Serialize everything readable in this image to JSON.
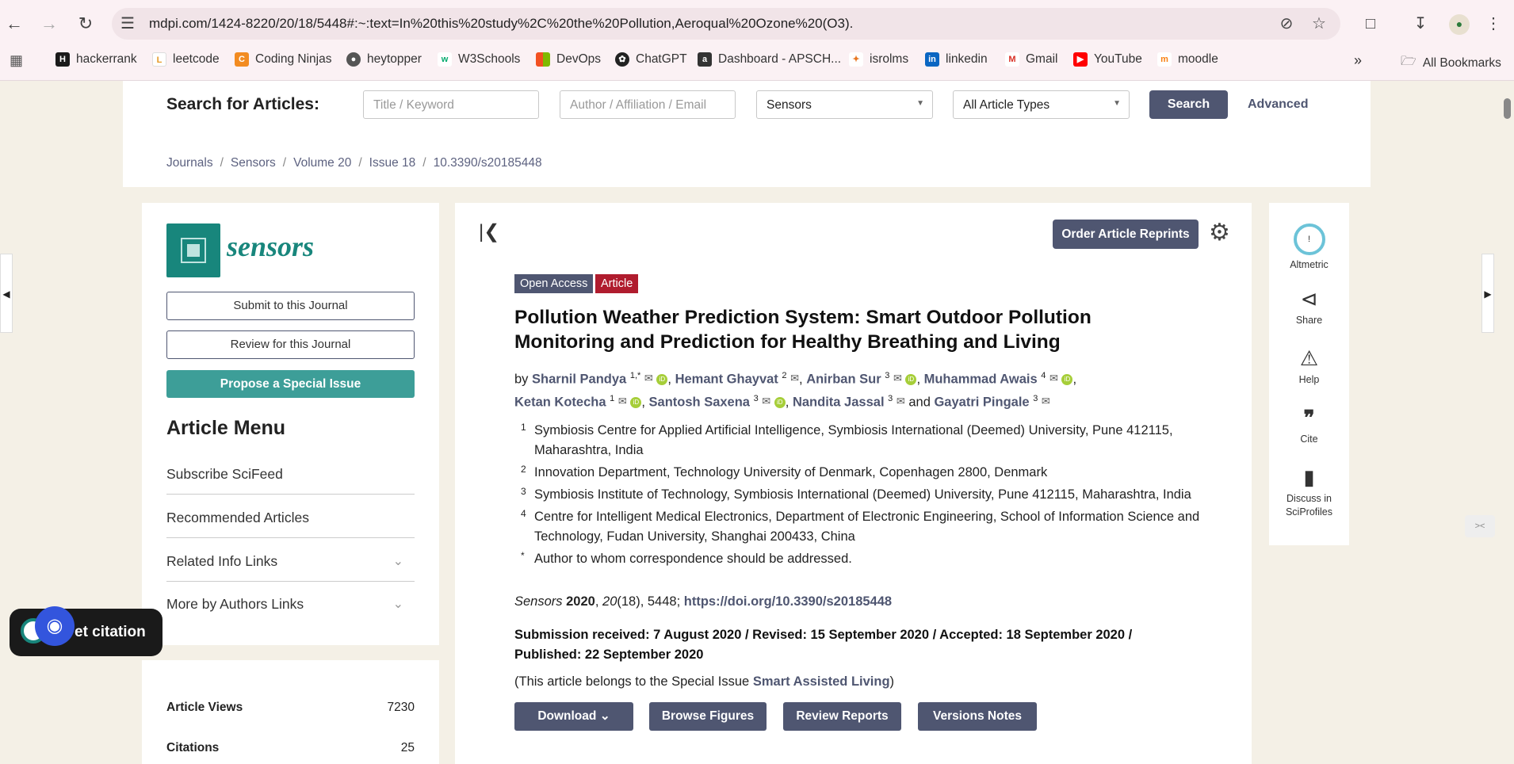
{
  "browser": {
    "url": "mdpi.com/1424-8220/20/18/5448#:~:text=In%20this%20study%2C%20the%20Pollution,Aeroqual%20Ozone%20(O3).",
    "bookmarks": [
      "hackerrank",
      "leetcode",
      "Coding Ninjas",
      "heytopper",
      "W3Schools",
      "DevOps",
      "ChatGPT",
      "Dashboard - APSCH...",
      "isrolms",
      "linkedin",
      "Gmail",
      "YouTube",
      "moodle"
    ],
    "all_bookmarks": "All Bookmarks"
  },
  "search": {
    "label": "Search for Articles:",
    "title_placeholder": "Title / Keyword",
    "author_placeholder": "Author / Affiliation / Email",
    "journal": "Sensors",
    "type": "All Article Types",
    "button": "Search",
    "advanced": "Advanced"
  },
  "breadcrumb": [
    "Journals",
    "Sensors",
    "Volume 20",
    "Issue 18",
    "10.3390/s20185448"
  ],
  "sidebar": {
    "journal_name": "sensors",
    "submit": "Submit to this Journal",
    "review": "Review for this Journal",
    "propose": "Propose a Special Issue",
    "menu_title": "Article Menu",
    "items": [
      "Subscribe SciFeed",
      "Recommended Articles",
      "Related Info Links",
      "More by Authors Links"
    ],
    "stats": [
      {
        "label": "Article Views",
        "value": "7230"
      },
      {
        "label": "Citations",
        "value": "25"
      }
    ]
  },
  "article": {
    "reprints": "Order Article Reprints",
    "badges": [
      "Open Access",
      "Article"
    ],
    "title": "Pollution Weather Prediction System: Smart Outdoor Pollution Monitoring and Prediction for Healthy Breathing and Living",
    "by": "by",
    "authors": [
      {
        "name": "Sharnil Pandya",
        "sup": "1,*"
      },
      {
        "name": "Hemant Ghayvat",
        "sup": "2"
      },
      {
        "name": "Anirban Sur",
        "sup": "3"
      },
      {
        "name": "Muhammad Awais",
        "sup": "4"
      },
      {
        "name": "Ketan Kotecha",
        "sup": "1"
      },
      {
        "name": "Santosh Saxena",
        "sup": "3"
      },
      {
        "name": "Nandita Jassal",
        "sup": "3"
      },
      {
        "name": "Gayatri Pingale",
        "sup": "3"
      }
    ],
    "and": "and",
    "affiliations": [
      {
        "n": "1",
        "text": "Symbiosis Centre for Applied Artificial Intelligence, Symbiosis International (Deemed) University, Pune 412115, Maharashtra, India"
      },
      {
        "n": "2",
        "text": "Innovation Department, Technology University of Denmark, Copenhagen 2800, Denmark"
      },
      {
        "n": "3",
        "text": "Symbiosis Institute of Technology, Symbiosis International (Deemed) University, Pune 412115, Maharashtra, India"
      },
      {
        "n": "4",
        "text": "Centre for Intelligent Medical Electronics, Department of Electronic Engineering, School of Information Science and Technology, Fudan University, Shanghai 200433, China"
      },
      {
        "n": "*",
        "text": "Author to whom correspondence should be addressed."
      }
    ],
    "journal_italic": "Sensors",
    "year": "2020",
    "volume": "20",
    "issue_pages": "(18), 5448;",
    "doi": "https://doi.org/10.3390/s20185448",
    "dates": "Submission received: 7 August 2020 / Revised: 15 September 2020 / Accepted: 18 September 2020 / Published: 22 September 2020",
    "special_prefix": "(This article belongs to the Special Issue",
    "special_name": "Smart Assisted Living",
    "special_suffix": ")",
    "buttons": [
      "Download",
      "Browse Figures",
      "Review Reports",
      "Versions Notes"
    ]
  },
  "right_panel": [
    "Altmetric",
    "Share",
    "Help",
    "Cite",
    "Discuss in SciProfiles"
  ],
  "floating": {
    "get_citation": "et citation"
  }
}
